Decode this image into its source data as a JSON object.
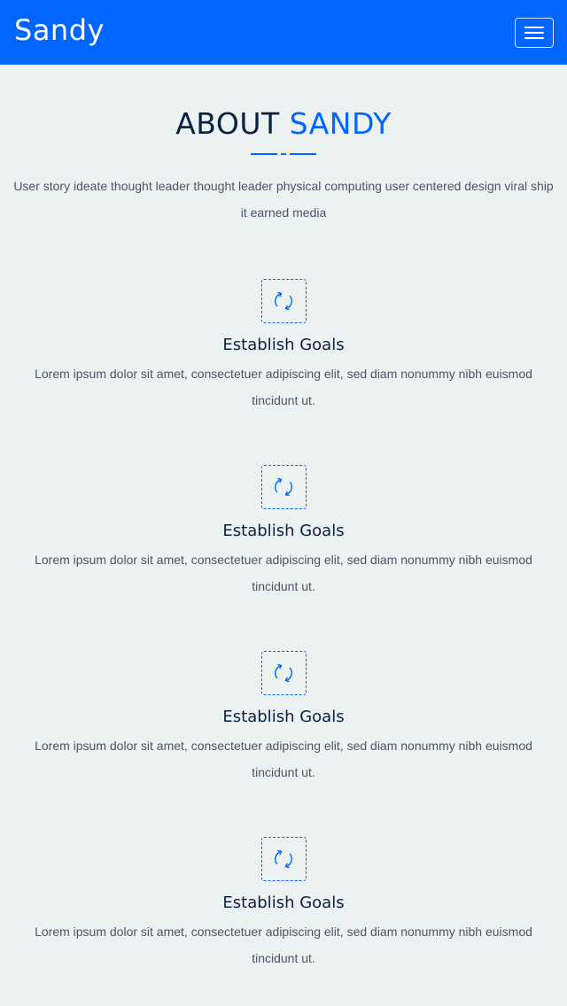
{
  "navbar": {
    "brand": "Sandy",
    "toggle_icon": "hamburger-menu-icon",
    "background_color": "#0066ff"
  },
  "about": {
    "title_main": "ABOUT",
    "title_accent": "SANDY",
    "intro": "User story ideate thought leader thought leader physical computing user centered design viral ship it earned media"
  },
  "features": [
    {
      "icon": "refresh-icon",
      "title": "Establish Goals",
      "text": "Lorem ipsum dolor sit amet, consectetuer adipiscing elit, sed diam nonummy nibh euismod tincidunt ut."
    },
    {
      "icon": "refresh-icon",
      "title": "Establish Goals",
      "text": "Lorem ipsum dolor sit amet, consectetuer adipiscing elit, sed diam nonummy nibh euismod tincidunt ut."
    },
    {
      "icon": "refresh-icon",
      "title": "Establish Goals",
      "text": "Lorem ipsum dolor sit amet, consectetuer adipiscing elit, sed diam nonummy nibh euismod tincidunt ut."
    },
    {
      "icon": "refresh-icon",
      "title": "Establish Goals",
      "text": "Lorem ipsum dolor sit amet, consectetuer adipiscing elit, sed diam nonummy nibh euismod tincidunt ut."
    }
  ],
  "colors": {
    "accent": "#0066ff",
    "heading": "#0b2140",
    "body_text": "#4a5566",
    "page_background": "#ecf2f2"
  }
}
